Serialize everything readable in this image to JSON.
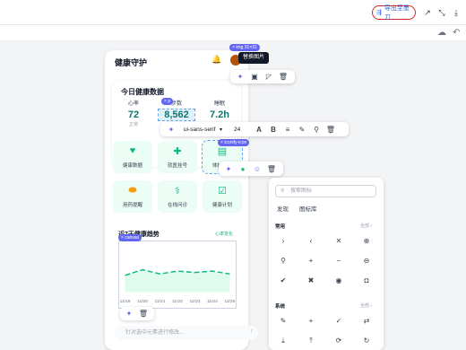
{
  "toolbar": {
    "export_label": "导出至墨刀"
  },
  "phone": {
    "title": "健康守护",
    "card": {
      "title": "今日健康数据",
      "stats": [
        {
          "label": "心率",
          "value": "72",
          "sub": "正常"
        },
        {
          "label": "步数",
          "value": "8,562",
          "sub": ""
        },
        {
          "label": "睡眠",
          "value": "7.2h",
          "sub": "良好"
        }
      ]
    },
    "grid": [
      {
        "label": "健康数据",
        "icon": "heart-pulse-icon"
      },
      {
        "label": "就医挂号",
        "icon": "plus-icon"
      },
      {
        "label": "体检报告",
        "icon": "document-icon"
      },
      {
        "label": "用药提醒",
        "icon": "pill-icon"
      },
      {
        "label": "在线问诊",
        "icon": "stethoscope-icon"
      },
      {
        "label": "健康计划",
        "icon": "calendar-check-icon"
      }
    ],
    "trend": {
      "title": "近7天健康趋势",
      "link": "心率变化"
    },
    "bottom_placeholder": "针对选中元素进行修改..."
  },
  "chart_data": {
    "type": "line",
    "x": [
      "11/19",
      "11/20",
      "11/21",
      "11/22",
      "11/23",
      "11/24",
      "11/25"
    ],
    "series": [
      {
        "values": [
          72,
          76,
          73,
          75,
          74,
          75,
          73
        ]
      }
    ],
    "ylim": [
      60,
      90
    ],
    "grid": false
  },
  "badges": {
    "img": "img 31×31",
    "p": "p",
    "iconify": "iconify-icon",
    "canvas": "canvas"
  },
  "tooltip": "替换图片",
  "text_toolbar": {
    "font": "ui-sans-serif",
    "size": "24"
  },
  "icon_panel": {
    "search_placeholder": "搜索图标",
    "tabs": [
      "发现",
      "图标库"
    ],
    "sections": [
      {
        "title": "常用",
        "more": "全部 ›"
      },
      {
        "title": "系统",
        "more": "全部 ›"
      }
    ],
    "common_icons": [
      "chevron-right-icon",
      "chevron-left-icon",
      "close-icon",
      "plus-circle-icon",
      "search-icon",
      "plus-icon",
      "minus-icon",
      "minus-circle-icon",
      "check-circle-icon",
      "x-circle-icon",
      "wechat-icon",
      "bag-icon"
    ],
    "system_icons": [
      "edit-icon",
      "plus-icon",
      "check-circle-outline-icon",
      "swap-icon",
      "download-icon",
      "upload-icon",
      "refresh-icon",
      "rotate-icon"
    ]
  },
  "colors": {
    "accent": "#10b981",
    "primary": "#6366f1",
    "export_border": "#dc2626"
  }
}
